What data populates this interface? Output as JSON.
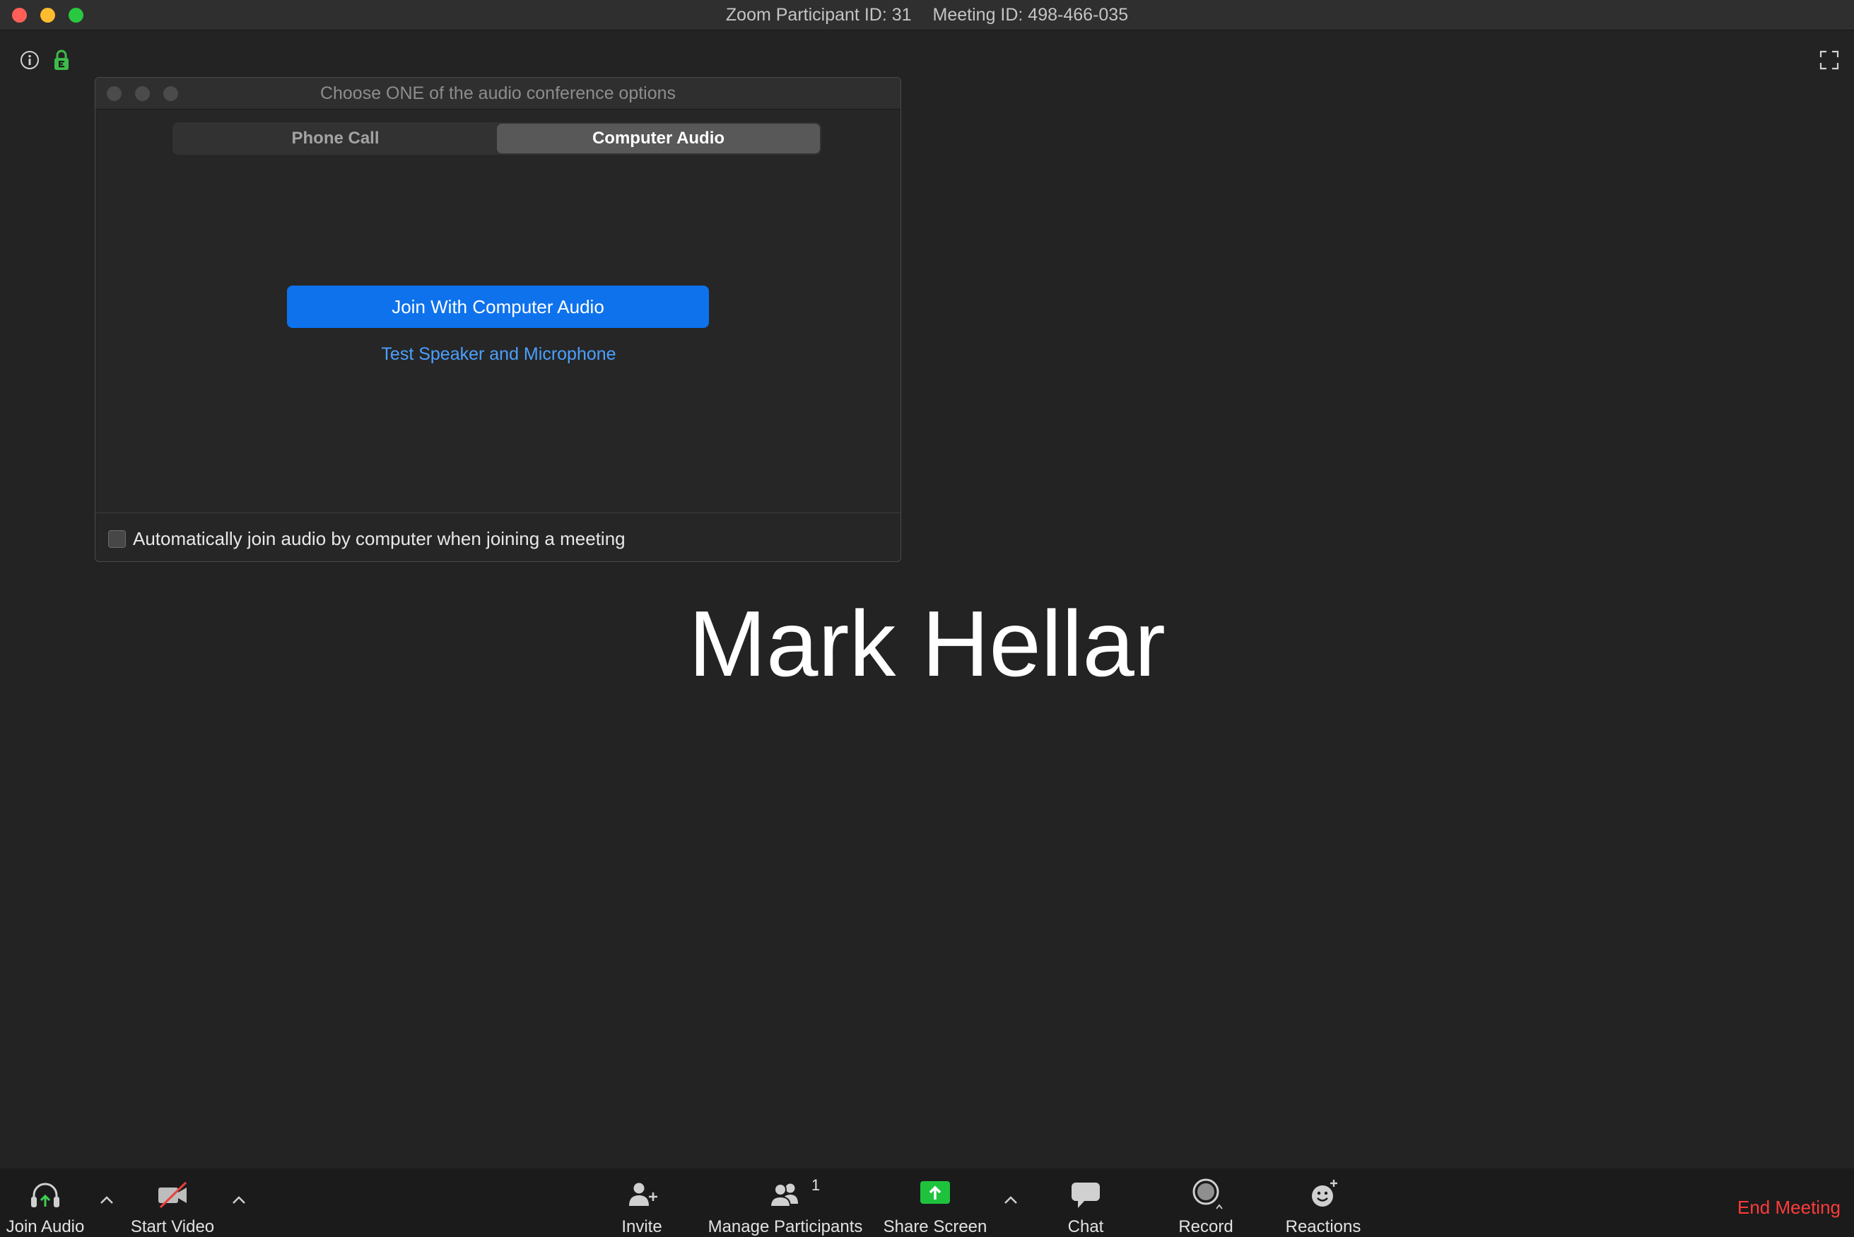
{
  "window": {
    "participant_id": "Zoom Participant ID: 31",
    "meeting_id": "Meeting ID: 498-466-035"
  },
  "top_icons": {
    "info": "info-icon",
    "security": "encryption-lock-icon",
    "fullscreen": "fullscreen-icon"
  },
  "dialog": {
    "title": "Choose ONE of the audio conference options",
    "tabs": [
      {
        "label": "Phone Call",
        "selected": false
      },
      {
        "label": "Computer Audio",
        "selected": true
      }
    ],
    "join_button_label": "Join With Computer Audio",
    "test_link_label": "Test Speaker and Microphone",
    "auto_join": {
      "label": "Automatically join audio by computer when joining a meeting",
      "checked": false
    }
  },
  "participant_name": "Mark Hellar",
  "toolbar": {
    "join_audio": {
      "label": "Join Audio",
      "icon": "headphones-icon"
    },
    "start_video": {
      "label": "Start Video",
      "icon": "video-off-icon"
    },
    "invite": {
      "label": "Invite",
      "icon": "add-person-icon"
    },
    "manage_participants": {
      "label": "Manage Participants",
      "icon": "participants-icon",
      "count": "1"
    },
    "share_screen": {
      "label": "Share Screen",
      "icon": "share-screen-icon"
    },
    "chat": {
      "label": "Chat",
      "icon": "chat-bubble-icon"
    },
    "record": {
      "label": "Record",
      "icon": "record-icon"
    },
    "reactions": {
      "label": "Reactions",
      "icon": "reactions-icon"
    },
    "end_meeting_label": "End Meeting"
  },
  "colors": {
    "accent": "#0e72ed",
    "link": "#4aa0ff",
    "danger": "#ff3b3b",
    "share": "#1fc23d",
    "lock": "#3dbb4a"
  }
}
